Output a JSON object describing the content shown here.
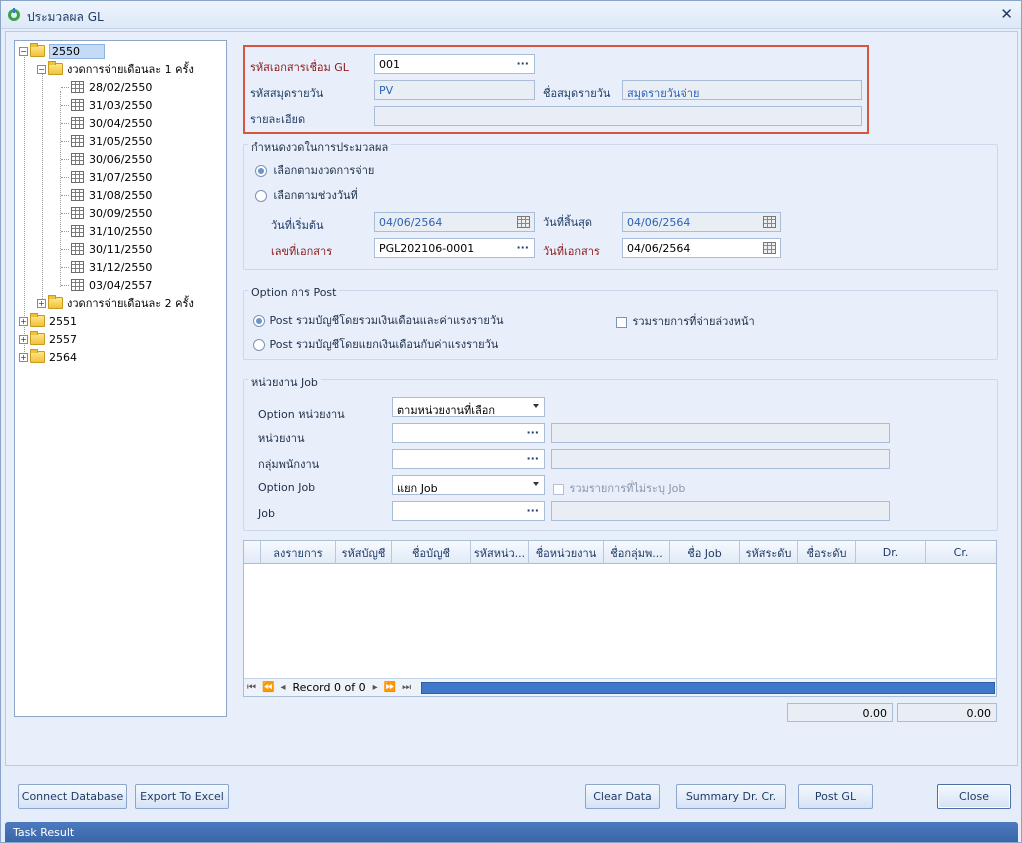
{
  "window": {
    "title": "ประมวลผล GL"
  },
  "tree": {
    "year_2550": "2550",
    "period1": "งวดการจ่ายเดือนละ 1 ครั้ง",
    "dates": [
      "28/02/2550",
      "31/03/2550",
      "30/04/2550",
      "31/05/2550",
      "30/06/2550",
      "31/07/2550",
      "31/08/2550",
      "30/09/2550",
      "31/10/2550",
      "30/11/2550",
      "31/12/2550",
      "03/04/2557"
    ],
    "period2": "งวดการจ่ายเดือนละ 2 ครั้ง",
    "year_2551": "2551",
    "year_2557": "2557",
    "year_2564": "2564"
  },
  "header": {
    "gl_doc_code_label": "รหัสเอกสารเชื่อม GL",
    "gl_doc_code_value": "001",
    "journal_code_label": "รหัสสมุดรายวัน",
    "journal_code_value": "PV",
    "journal_name_label": "ชื่อสมุดรายวัน",
    "journal_name_value": "สมุดรายวันจ่าย",
    "detail_label": "รายละเอียด",
    "detail_value": ""
  },
  "period_group": {
    "title": "กำหนดงวดในการประมวลผล",
    "option_by_pay_period": "เลือกตามงวดการจ่าย",
    "option_by_date_range": "เลือกตามช่วงวันที่",
    "start_date_label": "วันที่เริ่มต้น",
    "start_date_value": "04/06/2564",
    "end_date_label": "วันที่สิ้นสุด",
    "end_date_value": "04/06/2564",
    "doc_no_label": "เลขที่เอกสาร",
    "doc_no_value": "PGL202106-0001",
    "doc_date_label": "วันที่เอกสาร",
    "doc_date_value": "04/06/2564"
  },
  "post_group": {
    "title": "Option การ Post",
    "option_combined": "Post รวมบัญชีโดยรวมเงินเดือนและค่าแรงรายวัน",
    "option_separate": "Post รวมบัญชีโดยแยกเงินเดือนกับค่าแรงรายวัน",
    "include_prepaid": "รวมรายการที่จ่ายล่วงหน้า"
  },
  "job_group": {
    "title": "หน่วยงาน Job",
    "option_unit_label": "Option หน่วยงาน",
    "option_unit_value": "ตามหน่วยงานที่เลือก",
    "unit_label": "หน่วยงาน",
    "unit_value": "",
    "unit_name_value": "",
    "emp_group_label": "กลุ่มพนักงาน",
    "emp_group_value": "",
    "emp_group_name_value": "",
    "option_job_label": "Option Job",
    "option_job_value": "แยก Job",
    "include_no_job": "รวมรายการที่ไม่ระบุ Job",
    "job_label": "Job",
    "job_value": "",
    "job_name_value": ""
  },
  "grid": {
    "columns": [
      "ลงรายการ",
      "รหัสบัญชี",
      "ชื่อบัญชี",
      "รหัสหน่ว...",
      "ชื่อหน่วยงาน",
      "ชื่อกลุ่มพ...",
      "ชื่อ Job",
      "รหัสระดับ",
      "ชื่อระดับ",
      "Dr.",
      "Cr."
    ],
    "record_text": "Record 0 of 0",
    "total_dr": "0.00",
    "total_cr": "0.00"
  },
  "buttons": {
    "connect_db": "Connect Database",
    "export_excel": "Export To Excel",
    "clear_data": "Clear Data",
    "summary": "Summary Dr. Cr.",
    "post_gl": "Post GL",
    "close": "Close"
  },
  "status": {
    "text": "Task Result"
  },
  "colors": {
    "accent": "#3f78c8",
    "highlight_border": "#d9553d",
    "required_label": "#8b1a1a"
  }
}
